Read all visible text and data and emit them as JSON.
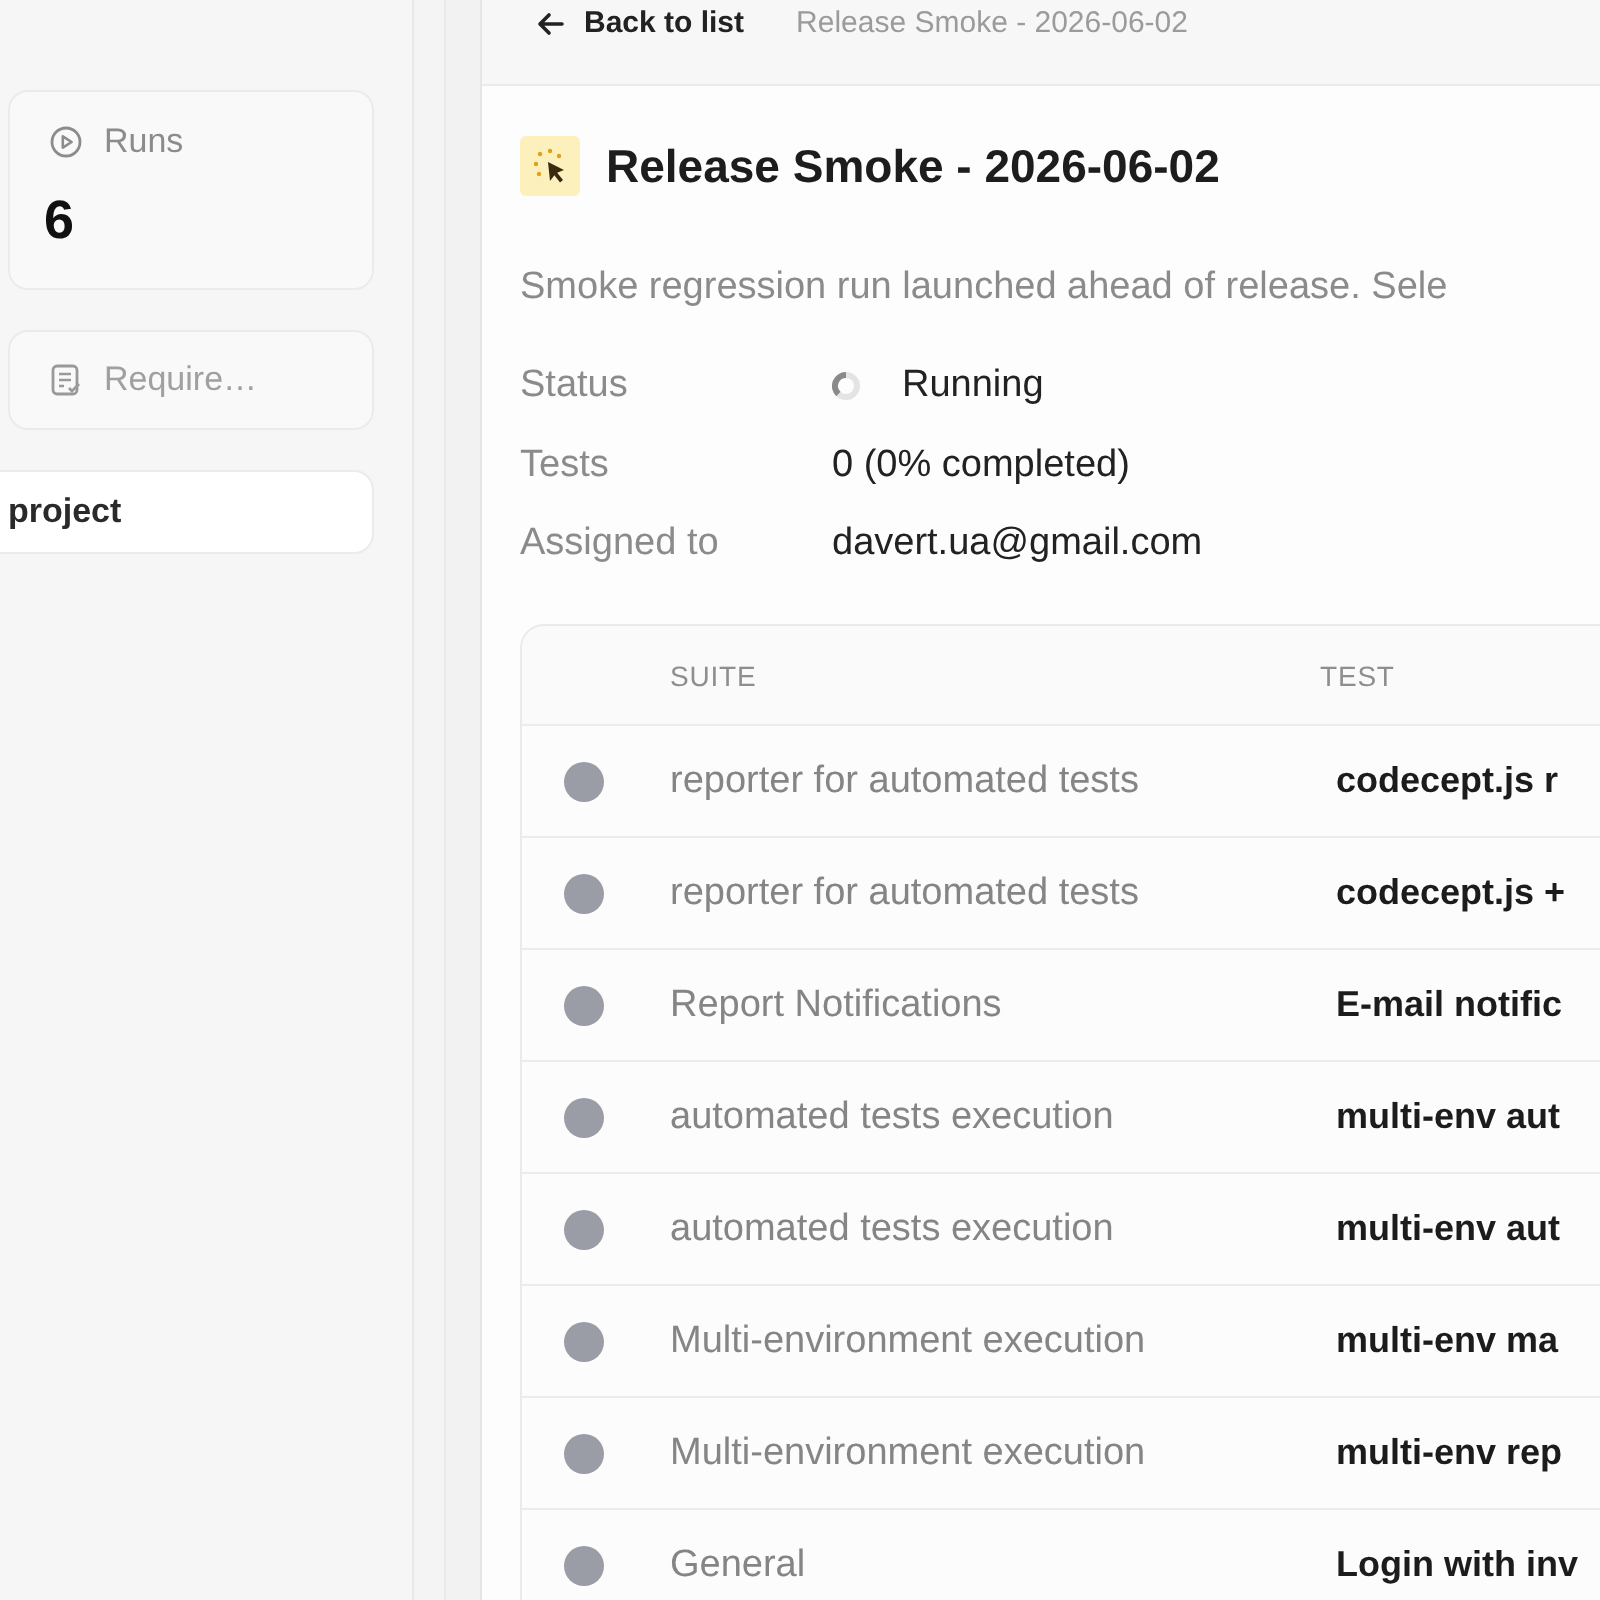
{
  "sidebar": {
    "cards": [
      {
        "kind": "stat",
        "label": "Runs",
        "value": "6"
      },
      {
        "kind": "link",
        "label": "Require…"
      },
      {
        "kind": "item",
        "label": "project"
      }
    ]
  },
  "breadcrumb": {
    "back": "Back to list",
    "current": "Release Smoke - 2026-06-02"
  },
  "run": {
    "title": "Release Smoke - 2026-06-02",
    "description": "Smoke regression run launched ahead of release. Sele",
    "details": [
      {
        "kind": "status",
        "label": "Status",
        "value": "Running"
      },
      {
        "kind": "text",
        "label": "Tests",
        "value": "0 (0% completed)"
      },
      {
        "kind": "text",
        "label": "Assigned to",
        "value": "davert.ua@gmail.com"
      }
    ]
  },
  "table": {
    "columns": [
      "SUITE",
      "TEST"
    ],
    "rows": [
      {
        "suite": "reporter for automated tests",
        "test": "codecept.js r",
        "color": "#9a9da6"
      },
      {
        "suite": "reporter for automated tests",
        "test": "codecept.js +",
        "color": "#9a9da6"
      },
      {
        "suite": "Report Notifications",
        "test": "E-mail notific",
        "color": "#9a9da6"
      },
      {
        "suite": "automated tests execution",
        "test": "multi-env aut",
        "color": "#9a9da6"
      },
      {
        "suite": "automated tests execution",
        "test": "multi-env aut",
        "color": "#9a9da6"
      },
      {
        "suite": "Multi-environment execution",
        "test": "multi-env ma",
        "color": "#9a9da6"
      },
      {
        "suite": "Multi-environment execution",
        "test": "multi-env rep",
        "color": "#9a9da6"
      },
      {
        "suite": "General",
        "test": "Login with inv",
        "color": "#9a9da6"
      }
    ]
  }
}
